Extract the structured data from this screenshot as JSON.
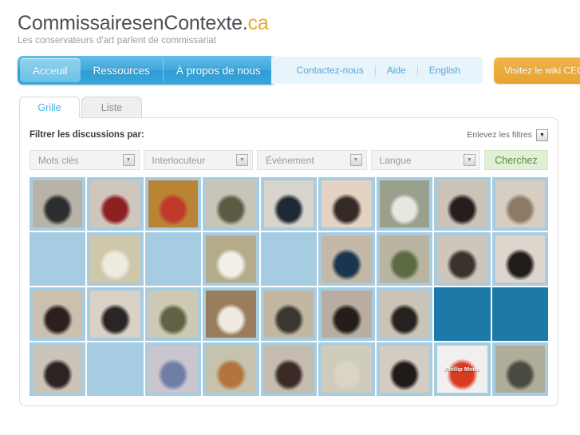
{
  "brand": {
    "name_main": "CommissairesenContexte.",
    "name_tld": "ca",
    "tagline": "Les conservateurs d'art parlent de commissariat"
  },
  "nav": {
    "primary": [
      {
        "label": "Acceuil",
        "active": true
      },
      {
        "label": "Ressources",
        "active": false
      },
      {
        "label": "À propos de nous",
        "active": false
      }
    ],
    "secondary": [
      {
        "label": "Contactez-nous"
      },
      {
        "label": "Aide"
      },
      {
        "label": "English"
      }
    ],
    "wiki_button": "Visitez le wiki CEC",
    "accent_blue": "#3fa9dd",
    "accent_orange": "#e8a331"
  },
  "tabs": [
    {
      "label": "Grille",
      "active": true
    },
    {
      "label": "Liste",
      "active": false
    }
  ],
  "filters": {
    "heading": "Filtrer les discussions par:",
    "clear_label": "Enlevez les filtres",
    "dropdown_glyph": "▼",
    "selects": [
      {
        "name": "mots-cles",
        "value": "Mots clés"
      },
      {
        "name": "interlocuteur",
        "value": "Interlocuteur"
      },
      {
        "name": "evenement",
        "value": "Événement"
      },
      {
        "name": "langue",
        "value": "Langue"
      }
    ],
    "search_label": "Cherchez"
  },
  "grid": {
    "columns": 9,
    "rows": 4,
    "empty_light_color": "#a6cce2",
    "empty_dark_color": "#1d79a8",
    "cells": [
      {
        "state": "photo",
        "tone": "#b9b2a6",
        "tone2": "#2c2e31",
        "caption": ""
      },
      {
        "state": "photo",
        "tone": "#cfc6bd",
        "tone2": "#8d2023",
        "caption": ""
      },
      {
        "state": "photo",
        "tone": "#b98433",
        "tone2": "#c0392b",
        "caption": ""
      },
      {
        "state": "photo",
        "tone": "#c8c4b7",
        "tone2": "#5a5b42",
        "caption": ""
      },
      {
        "state": "photo",
        "tone": "#d8d4cb",
        "tone2": "#1d2a36",
        "caption": ""
      },
      {
        "state": "photo",
        "tone": "#e4d2c2",
        "tone2": "#352a28",
        "caption": ""
      },
      {
        "state": "photo",
        "tone": "#9aa08c",
        "tone2": "#e8e6e1",
        "caption": ""
      },
      {
        "state": "photo",
        "tone": "#cbc3b8",
        "tone2": "#241f1d",
        "caption": ""
      },
      {
        "state": "photo",
        "tone": "#d6cec2",
        "tone2": "#8d7a63",
        "caption": ""
      },
      {
        "state": "empty-light",
        "tone": "",
        "tone2": "",
        "caption": ""
      },
      {
        "state": "photo",
        "tone": "#cfc7a9",
        "tone2": "#efeae0",
        "caption": ""
      },
      {
        "state": "empty-light",
        "tone": "",
        "tone2": "",
        "caption": ""
      },
      {
        "state": "photo",
        "tone": "#b4ab8a",
        "tone2": "#f2efe8",
        "caption": ""
      },
      {
        "state": "empty-light",
        "tone": "",
        "tone2": "",
        "caption": ""
      },
      {
        "state": "photo",
        "tone": "#c4b9a6",
        "tone2": "#1b3550",
        "caption": ""
      },
      {
        "state": "photo",
        "tone": "#b9b49f",
        "tone2": "#5d6b45",
        "caption": ""
      },
      {
        "state": "photo",
        "tone": "#cfc6bb",
        "tone2": "#3a332c",
        "caption": ""
      },
      {
        "state": "photo",
        "tone": "#dcd6cc",
        "tone2": "#221d1b",
        "caption": ""
      },
      {
        "state": "photo",
        "tone": "#cdbfae",
        "tone2": "#2a211f",
        "caption": ""
      },
      {
        "state": "photo",
        "tone": "#d7d1c6",
        "tone2": "#2a2523",
        "caption": ""
      },
      {
        "state": "photo",
        "tone": "#cdc9b4",
        "tone2": "#5f6344",
        "caption": ""
      },
      {
        "state": "photo",
        "tone": "#9a7d5c",
        "tone2": "#efeae2",
        "caption": ""
      },
      {
        "state": "photo",
        "tone": "#c3b7a4",
        "tone2": "#3b3630",
        "caption": ""
      },
      {
        "state": "photo",
        "tone": "#b8ada0",
        "tone2": "#231e1c",
        "caption": ""
      },
      {
        "state": "photo",
        "tone": "#cac4b6",
        "tone2": "#26221f",
        "caption": ""
      },
      {
        "state": "empty-dark",
        "tone": "",
        "tone2": "",
        "caption": ""
      },
      {
        "state": "empty-dark",
        "tone": "",
        "tone2": "",
        "caption": ""
      },
      {
        "state": "photo",
        "tone": "#cbc4b8",
        "tone2": "#2b2422",
        "caption": ""
      },
      {
        "state": "empty-light",
        "tone": "",
        "tone2": "",
        "caption": ""
      },
      {
        "state": "photo",
        "tone": "#c9c6cd",
        "tone2": "#6f7ea6",
        "caption": ""
      },
      {
        "state": "photo",
        "tone": "#c5c3ae",
        "tone2": "#b4753c",
        "caption": ""
      },
      {
        "state": "photo",
        "tone": "#c4bcae",
        "tone2": "#3c2a26",
        "caption": ""
      },
      {
        "state": "photo",
        "tone": "#cfccbc",
        "tone2": "#d9d4c6",
        "caption": ""
      },
      {
        "state": "photo",
        "tone": "#d2ccc2",
        "tone2": "#201b19",
        "caption": ""
      },
      {
        "state": "photo",
        "tone": "#f2f0ee",
        "tone2": "#d93b22",
        "caption": "Phillip Monk"
      },
      {
        "state": "photo",
        "tone": "#b0ac9a",
        "tone2": "#4a4a42",
        "caption": ""
      }
    ]
  }
}
